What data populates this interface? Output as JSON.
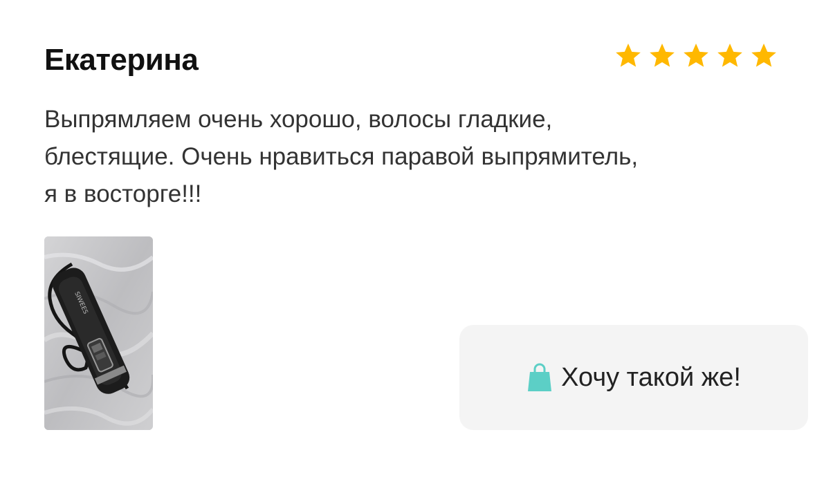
{
  "review": {
    "author": "Екатерина",
    "rating": 5,
    "rating_max": 5,
    "text_lines": [
      "Выпрямляем очень хорошо, волосы гладкие,",
      "блестящие. Очень нравиться паравой выпрямитель,",
      "я в восторге!!!"
    ],
    "photo_label": "SIWEES"
  },
  "cta": {
    "label": "Хочу такой же!",
    "icon": "shopping-bag-icon"
  },
  "colors": {
    "star": "#FFB800",
    "cta_background": "#F4F4F4",
    "bag": "#5CCFC6",
    "text": "#333333",
    "author": "#111111"
  }
}
